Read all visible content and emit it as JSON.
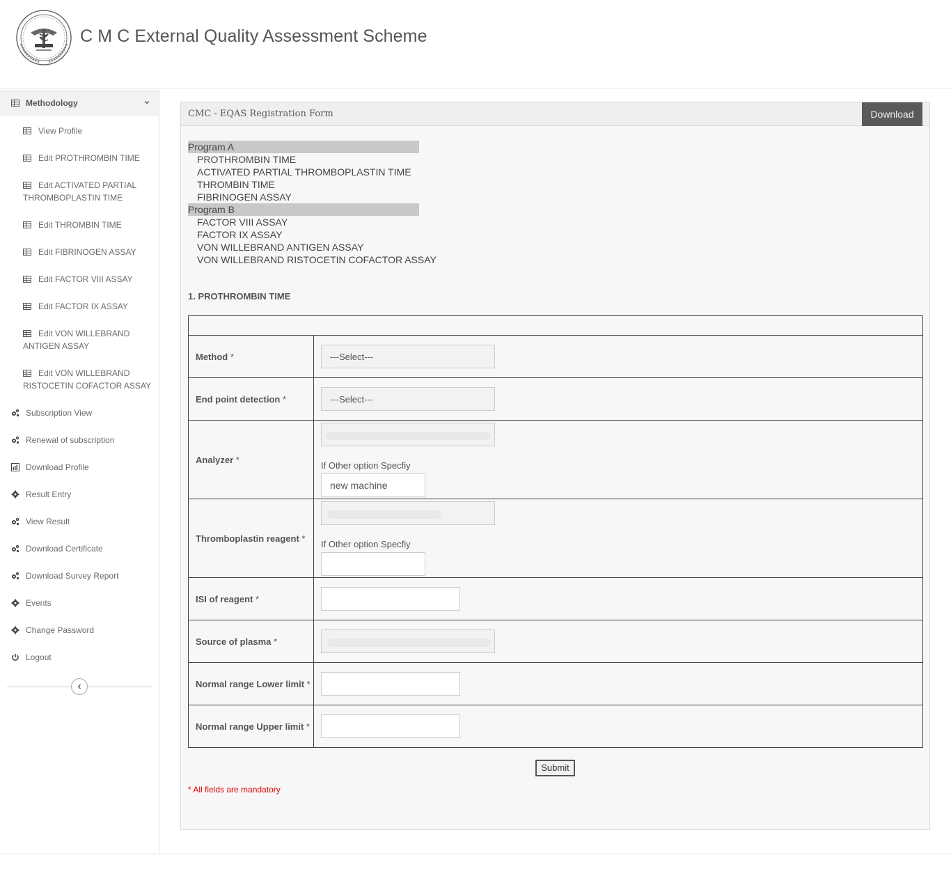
{
  "header": {
    "site_title": "C M C External Quality Assessment Scheme"
  },
  "sidebar": {
    "section": "Methodology",
    "sub_items": [
      "View Profile",
      "Edit PROTHROMBIN TIME",
      "Edit ACTIVATED PARTIAL THROMBOPLASTIN TIME",
      "Edit THROMBIN TIME",
      "Edit FIBRINOGEN ASSAY",
      "Edit FACTOR VIII ASSAY",
      "Edit FACTOR IX ASSAY",
      "Edit VON WILLEBRAND ANTIGEN ASSAY",
      "Edit VON WILLEBRAND RISTOCETIN COFACTOR ASSAY"
    ],
    "items": [
      "Subscription View",
      "Renewal of subscription",
      "Download Profile",
      "Result Entry",
      "View Result",
      "Download Certificate",
      "Download Survey Report",
      "Events",
      "Change Password",
      "Logout"
    ]
  },
  "panel": {
    "title": "CMC - EQAS Registration Form",
    "download_label": "Download"
  },
  "programs": [
    {
      "name": "Program A",
      "tests": [
        "PROTHROMBIN TIME",
        "ACTIVATED PARTIAL THROMBOPLASTIN TIME",
        "THROMBIN TIME",
        "FIBRINOGEN ASSAY"
      ]
    },
    {
      "name": "Program B",
      "tests": [
        "FACTOR VIII ASSAY",
        "FACTOR IX ASSAY",
        "VON WILLEBRAND ANTIGEN ASSAY",
        "VON WILLEBRAND RISTOCETIN COFACTOR ASSAY"
      ]
    }
  ],
  "form": {
    "section_title": "1. PROTHROMBIN TIME",
    "required_mark": "*",
    "select_placeholder": "---Select---",
    "other_label": "If Other option Specfiy",
    "labels": {
      "method": "Method",
      "end_point": "End point detection",
      "analyzer": "Analyzer",
      "thromboplastin": "Thromboplastin reagent",
      "isi": "ISI of reagent",
      "source_plasma": "Source of plasma",
      "lower_limit": "Normal range Lower limit",
      "upper_limit": "Normal range Upper limit"
    },
    "values": {
      "analyzer_other": "new machine",
      "thromboplastin_other": "",
      "isi": "",
      "lower_limit": "",
      "upper_limit": ""
    },
    "submit_label": "Submit",
    "mandatory_note": "* All fields are mandatory"
  }
}
